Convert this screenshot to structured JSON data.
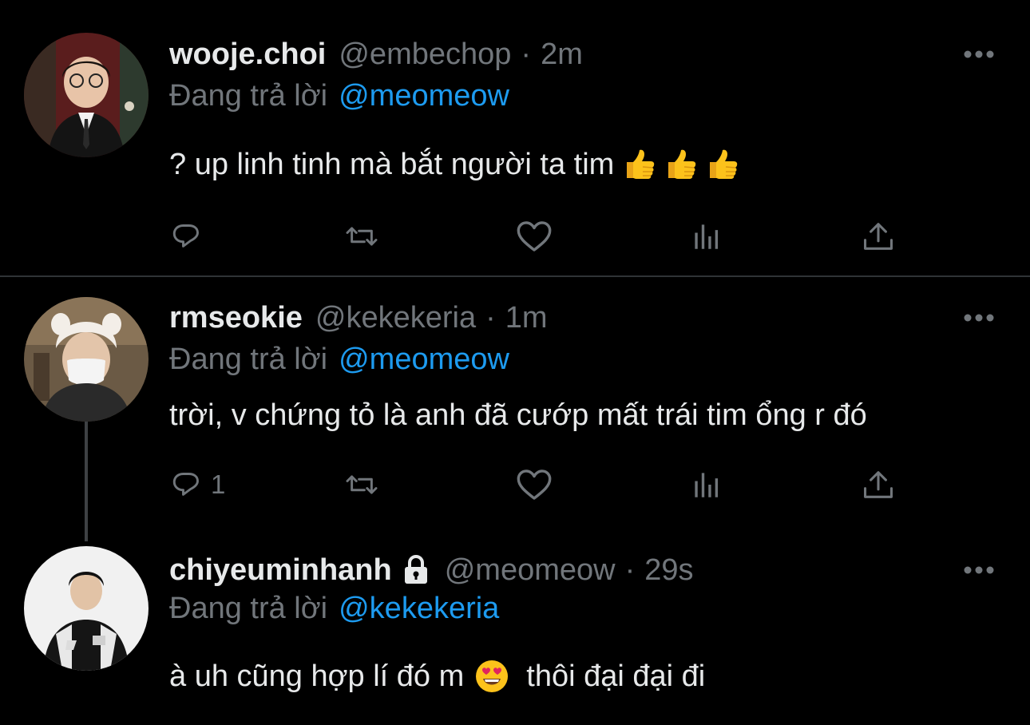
{
  "tweets": [
    {
      "display_name": "wooje.choi",
      "handle": "@embechop",
      "separator": "·",
      "time": "2m",
      "reply_prefix": "Đang trả lời",
      "reply_to": "@meomeow",
      "text": "? up linh tinh mà bắt người ta tim",
      "emoji": [
        "thumbs-up",
        "thumbs-up",
        "thumbs-up"
      ],
      "reply_count": ""
    },
    {
      "display_name": "rmseokie",
      "handle": "@kekekeria",
      "separator": "·",
      "time": "1m",
      "reply_prefix": "Đang trả lời",
      "reply_to": "@meomeow",
      "text": "trời, v chứng tỏ là anh đã cướp mất trái tim ổng r đó",
      "reply_count": "1"
    },
    {
      "display_name": "chiyeuminhanh",
      "protected": true,
      "handle": "@meomeow",
      "separator": "·",
      "time": "29s",
      "reply_prefix": "Đang trả lời",
      "reply_to": "@kekekeria",
      "text_before_emoji": "à uh cũng hợp lí đó m",
      "emoji": "heart-eyes",
      "text_after_emoji": "thôi đại đại đi"
    }
  ],
  "actions": [
    "reply-icon",
    "retweet-icon",
    "like-icon",
    "analytics-icon",
    "share-icon"
  ],
  "colors": {
    "background": "#000000",
    "text": "#e7e9ea",
    "muted": "#71767b",
    "link": "#1d9bf0",
    "divider": "#2f3336"
  }
}
